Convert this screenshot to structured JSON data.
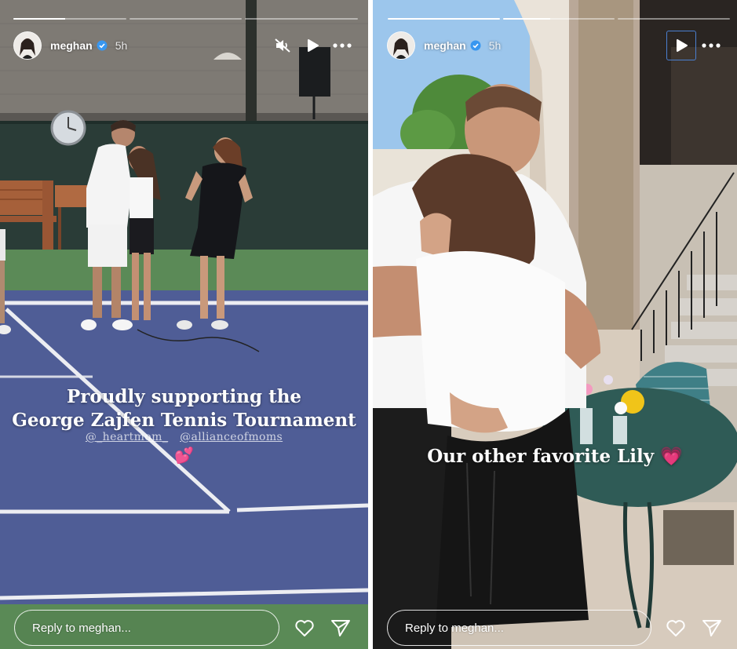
{
  "stories": [
    {
      "user": {
        "username": "meghan",
        "verified": true,
        "timestamp": "5h",
        "avatar": "avatar"
      },
      "progress": [
        0.46,
        0,
        0
      ],
      "controls": [
        "unmute-icon",
        "play-icon",
        "more-options-icon"
      ],
      "caption_lines": [
        "Proudly supporting the",
        "George Zajfen Tennis Tournament"
      ],
      "mentions": [
        "@_heartmom_",
        "@allianceofmoms"
      ],
      "emoji": "💕",
      "reply_placeholder": "Reply to meghan...",
      "actions": [
        "heart-icon",
        "send-icon"
      ]
    },
    {
      "user": {
        "username": "meghan",
        "verified": true,
        "timestamp": "5h",
        "avatar": "avatar"
      },
      "progress": [
        1,
        0.42,
        0
      ],
      "controls": [
        "play-icon",
        "more-options-icon"
      ],
      "caption": "Our other favorite Lily 💗",
      "reply_placeholder": "Reply to meghan...",
      "actions": [
        "heart-icon",
        "send-icon"
      ]
    }
  ],
  "colors": {
    "verified_badge": "#3897f0",
    "focus_ring": "#4a7fd0",
    "court_blue": "#4f5d96",
    "court_green": "#5c8a5a"
  }
}
